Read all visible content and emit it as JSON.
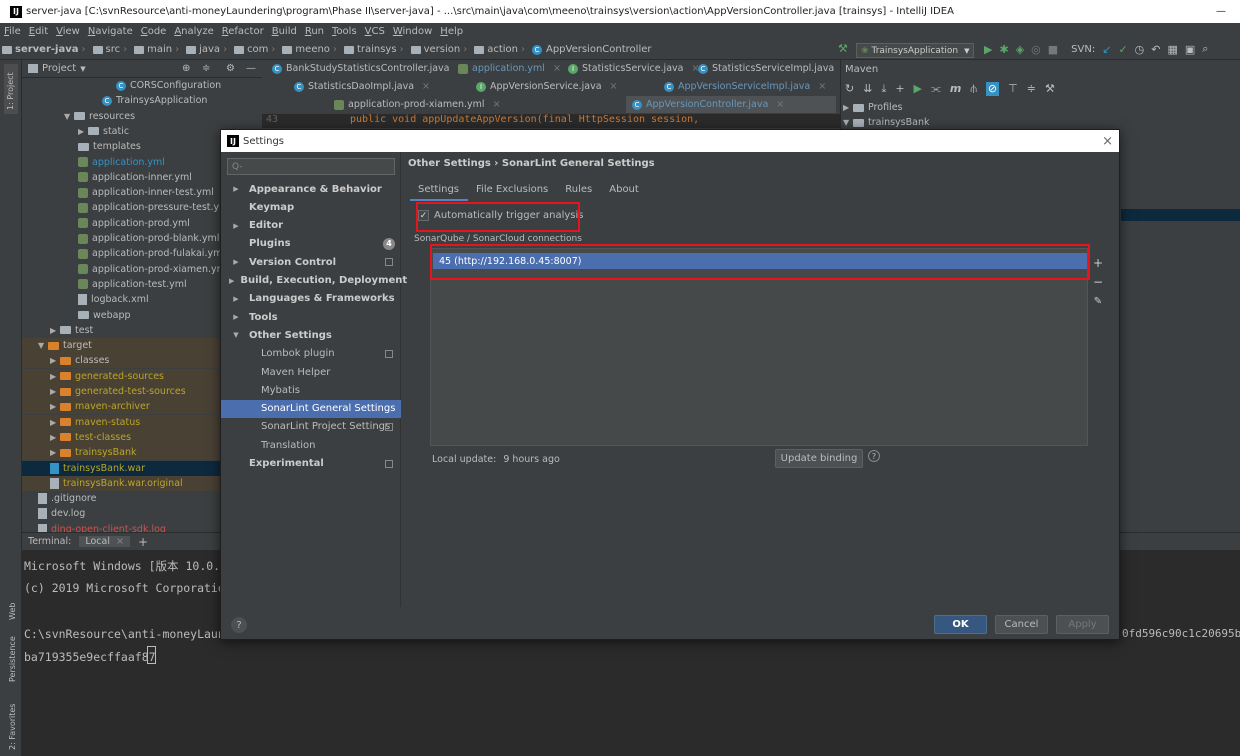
{
  "titlebar": {
    "text": "server-java [C:\\svnResource\\anti-moneyLaundering\\program\\Phase II\\server-java] - ...\\src\\main\\java\\com\\meeno\\trainsys\\version\\action\\AppVersionController.java [trainsys] - IntelliJ IDEA",
    "min": "—"
  },
  "menu": [
    "File",
    "Edit",
    "View",
    "Navigate",
    "Code",
    "Analyze",
    "Refactor",
    "Build",
    "Run",
    "Tools",
    "VCS",
    "Window",
    "Help"
  ],
  "breadcrumb": [
    "server-java",
    "src",
    "main",
    "java",
    "com",
    "meeno",
    "trainsys",
    "version",
    "action",
    "AppVersionController"
  ],
  "run_config": "TrainsysApplication",
  "svn_label": "SVN:",
  "project_header": "Project",
  "tree": [
    {
      "label": "CORSConfiguration"
    },
    {
      "label": "TrainsysApplication"
    },
    {
      "label": "resources"
    },
    {
      "label": "static"
    },
    {
      "label": "templates"
    },
    {
      "label": "application.yml"
    },
    {
      "label": "application-inner.yml"
    },
    {
      "label": "application-inner-test.yml"
    },
    {
      "label": "application-pressure-test.ym"
    },
    {
      "label": "application-prod.yml"
    },
    {
      "label": "application-prod-blank.yml"
    },
    {
      "label": "application-prod-fulakai.ym"
    },
    {
      "label": "application-prod-xiamen.ym"
    },
    {
      "label": "application-test.yml"
    },
    {
      "label": "logback.xml"
    },
    {
      "label": "webapp"
    },
    {
      "label": "test"
    },
    {
      "label": "target"
    },
    {
      "label": "classes"
    },
    {
      "label": "generated-sources"
    },
    {
      "label": "generated-test-sources"
    },
    {
      "label": "maven-archiver"
    },
    {
      "label": "maven-status"
    },
    {
      "label": "test-classes"
    },
    {
      "label": "trainsysBank"
    },
    {
      "label": "trainsysBank.war"
    },
    {
      "label": "trainsysBank.war.original"
    },
    {
      "label": ".gitignore"
    },
    {
      "label": "dev.log"
    },
    {
      "label": "ding-open-client-sdk.log"
    }
  ],
  "editor_tabs": [
    "BankStudyStatisticsController.java",
    "application.yml",
    "StatisticsService.java",
    "StatisticsServiceImpl.java",
    "StatisticsDaoImpl.java",
    "AppVersionService.java",
    "AppVersionServiceImpl.java",
    "application-prod-xiamen.yml",
    "AppVersionController.java"
  ],
  "editor": {
    "line_no": "43",
    "code": "public void appUpdateAppVersion(final HttpSession session,"
  },
  "maven": {
    "title": "Maven",
    "profiles": "Profiles",
    "project": "trainsysBank"
  },
  "terminal": {
    "tab_label": "Terminal:",
    "session": "Local",
    "lines": [
      "Microsoft Windows [版本 10.0.1",
      "(c) 2019 Microsoft Corporatio",
      "",
      "C:\\svnResource\\anti-moneyLaund",
      "ba719355e9ecffaaf87"
    ],
    "right_text": "0fd596c90c1c20695b"
  },
  "left_tool": {
    "project": "1: Project",
    "web": "Web",
    "persistence": "Persistence",
    "favorites": "2: Favorites"
  },
  "dialog": {
    "title": "Settings",
    "search_placeholder": "Q-",
    "nav": [
      {
        "label": "Appearance & Behavior"
      },
      {
        "label": "Keymap"
      },
      {
        "label": "Editor"
      },
      {
        "label": "Plugins",
        "badge": "4"
      },
      {
        "label": "Version Control"
      },
      {
        "label": "Build, Execution, Deployment"
      },
      {
        "label": "Languages & Frameworks"
      },
      {
        "label": "Tools"
      },
      {
        "label": "Other Settings"
      },
      {
        "label": "Lombok plugin"
      },
      {
        "label": "Maven Helper"
      },
      {
        "label": "Mybatis"
      },
      {
        "label": "SonarLint General Settings"
      },
      {
        "label": "SonarLint Project Settings"
      },
      {
        "label": "Translation"
      },
      {
        "label": "Experimental"
      }
    ],
    "breadcrumb": "Other Settings  ›  SonarLint General Settings",
    "tabs": [
      "Settings",
      "File Exclusions",
      "Rules",
      "About"
    ],
    "auto_trigger": "Automatically trigger analysis",
    "connections_label": "SonarQube / SonarCloud connections",
    "connection": "45    (http://192.168.0.45:8007)",
    "local_update_label": "Local update:",
    "local_update_value": "9 hours ago",
    "update_binding": "Update binding",
    "ok": "OK",
    "cancel": "Cancel",
    "apply": "Apply"
  }
}
